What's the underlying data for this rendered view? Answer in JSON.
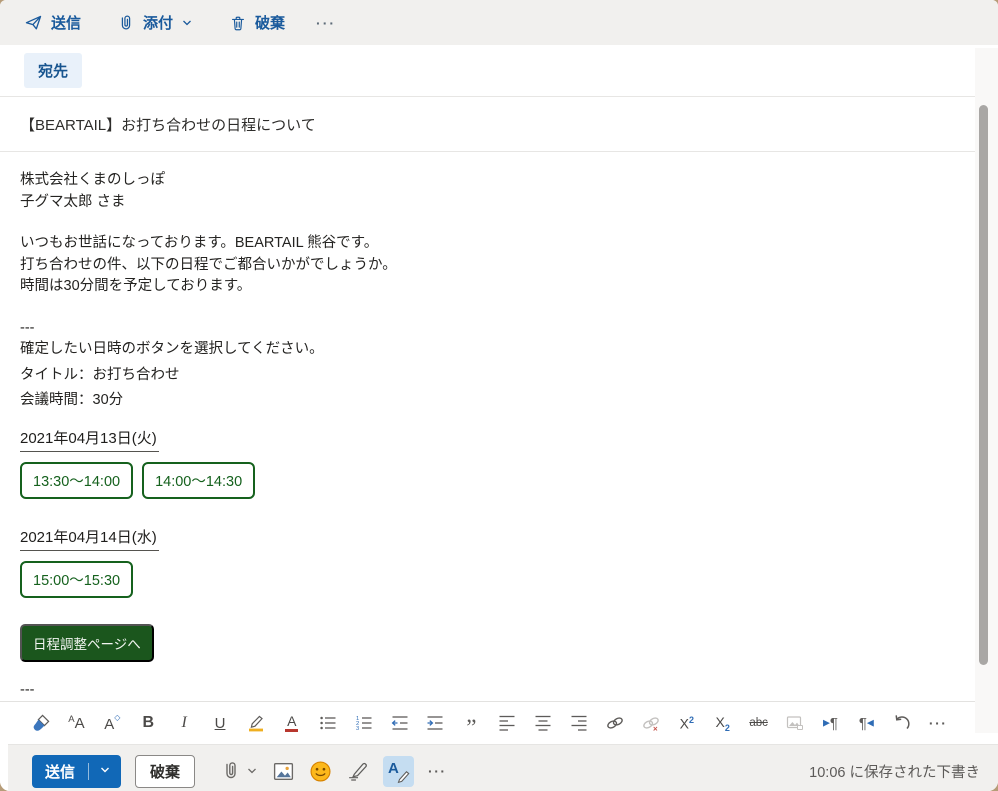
{
  "top_toolbar": {
    "send_label": "送信",
    "attach_label": "添付",
    "discard_label": "破棄",
    "more_label": "···",
    "icons": [
      "send-plane-icon",
      "paperclip-icon",
      "chevron-down-icon",
      "trash-icon",
      "more-options-icon"
    ]
  },
  "compose": {
    "to_button_label": "宛先",
    "subject": "【BEARTAIL】お打ち合わせの日程について",
    "greeting": [
      "株式会社くまのしっぽ",
      "子グマ太郎 さま"
    ],
    "intro": [
      "いつもお世話になっております。BEARTAIL 熊谷です。",
      "打ち合わせの件、以下の日程でご都合いかがでしょうか。",
      "時間は30分間を予定しております。"
    ],
    "divider": "---",
    "instruction": "確定したい日時のボタンを選択してください。",
    "meeting_title": "タイトル：お打ち合わせ",
    "meeting_duration": "会議時間：30分",
    "days": [
      {
        "date": "2021年04月13日(火)",
        "slots": [
          "13:30～14:00",
          "14:00～14:30"
        ]
      },
      {
        "date": "2021年04月14日(水)",
        "slots": [
          "15:00～15:30"
        ]
      }
    ],
    "schedule_page_button": "日程調整ページへ",
    "closing_divider": "---"
  },
  "format_toolbar": {
    "icons": [
      "format-painter",
      "font",
      "font-size",
      "bold",
      "italic",
      "underline",
      "text-highlight",
      "font-color",
      "bullet-list",
      "numbered-list",
      "decrease-indent",
      "increase-indent",
      "quote",
      "align-left",
      "align-center",
      "align-right",
      "insert-link",
      "remove-link",
      "superscript",
      "subscript",
      "strikethrough",
      "insert-image",
      "left-to-right",
      "right-to-left",
      "undo",
      "more"
    ],
    "letters": {
      "font": "A",
      "font_size": "A",
      "bold": "B",
      "italic": "I",
      "underline": "U",
      "font_color": "A",
      "superscript": "X",
      "subscript": "X",
      "script_digit": "2",
      "strikethrough": "abc",
      "quote": "”",
      "more": "···"
    }
  },
  "bottom_bar": {
    "send_label": "送信",
    "discard_label": "破棄",
    "more_label": "···",
    "status": "10:06 に保存された下書き",
    "icons": [
      "paperclip-icon",
      "chevron-down-icon",
      "insert-image-icon",
      "emoji-icon",
      "ink-pen-icon",
      "editor-icon",
      "more-options-icon"
    ]
  },
  "colors": {
    "command_blue": "#1a5a9c",
    "primary_button_blue": "#1168b7",
    "slot_green": "#15611d",
    "schedule_button_green": "#1b561d",
    "toolbar_background": "#f1f0ee",
    "to_chip_background": "#e9f1fa"
  }
}
